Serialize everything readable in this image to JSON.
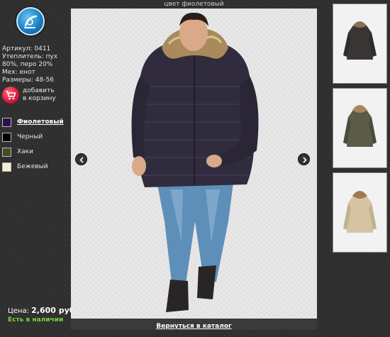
{
  "viewer": {
    "title": "цвет фиолетовый",
    "back_link": "Вернуться в каталог"
  },
  "product": {
    "specs": [
      "Артикул: 0411",
      "Утеплитель: пух",
      "80%, перо 20%",
      "Мех: енот",
      "Размеры: 48-56"
    ],
    "cart_label_1": "добавить",
    "cart_label_2": "в корзину",
    "price_label": "Цена:",
    "price_value": "2,600 руб.",
    "availability": "Есть в наличии"
  },
  "colors": [
    {
      "label": "Фиолетовый",
      "hex": "#2d0f52",
      "active": true
    },
    {
      "label": "Черный",
      "hex": "#000000",
      "active": false
    },
    {
      "label": "Хаки",
      "hex": "#4b4a24",
      "active": false
    },
    {
      "label": "Бежевый",
      "hex": "#f6eed0",
      "active": false
    }
  ],
  "thumbnails": [
    {
      "icon": "jacket-dark-thumbnail"
    },
    {
      "icon": "jacket-khaki-thumbnail"
    },
    {
      "icon": "jacket-beige-thumbnail"
    }
  ]
}
